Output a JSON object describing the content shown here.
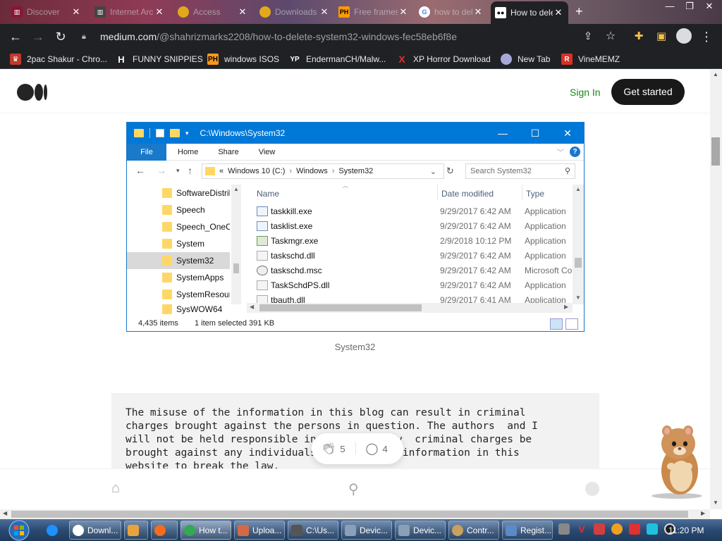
{
  "browser": {
    "tabs": [
      {
        "title": "Discover",
        "fav_color": "#8a1538",
        "active": false
      },
      {
        "title": "Internet Archive",
        "fav_color": "#444444",
        "active": false
      },
      {
        "title": "Access",
        "fav_color": "#e2a91b",
        "active": false
      },
      {
        "title": "Downloads",
        "fav_color": "#e2a91b",
        "active": false
      },
      {
        "title": "Free frames",
        "fav_color": "#f90",
        "active": false
      },
      {
        "title": "how to delete",
        "fav_color": "#4285f4",
        "active": false
      },
      {
        "title": "How to delete",
        "fav_color": "#ffffff",
        "active": true
      }
    ],
    "new_tab": "+",
    "url_host": "medium.com",
    "url_path": "/@shahrizmarks2208/how-to-delete-system32-windows-fec58eb6f8e",
    "bookmarks": [
      {
        "label": "2pac Shakur - Chro...",
        "icon": "2pac-icon",
        "color": "#c03a2b"
      },
      {
        "label": "FUNNY SNIPPIES",
        "icon": "H",
        "color": "#ffffff"
      },
      {
        "label": "windows ISOS",
        "icon": "PH",
        "color": "#f7971d"
      },
      {
        "label": "EndermanCH/Malw...",
        "icon": "YP",
        "color": "#ffffff"
      },
      {
        "label": "XP Horror Download",
        "icon": "X",
        "color": "#e52e2e"
      },
      {
        "label": "New Tab",
        "icon": "globe-icon",
        "color": "#a8a8d8"
      },
      {
        "label": "VineMEMZ",
        "icon": "R",
        "color": "#d93025"
      }
    ]
  },
  "medium": {
    "sign_in": "Sign In",
    "get_started": "Get started",
    "caption": "System32",
    "claps": "5",
    "comments": "4",
    "code_lines": [
      "The misuse of the information in this blog can result in criminal",
      "charges brought against the persons in question. The authors  and I",
      "will not be held responsible in the event any  criminal charges be",
      "brought against any individuals misusing the information in this",
      "website to break the law."
    ]
  },
  "explorer": {
    "title_path": "C:\\Windows\\System32",
    "ribbon_file": "File",
    "ribbon_tabs": [
      "Home",
      "Share",
      "View"
    ],
    "address": {
      "prefix": "«",
      "parts": [
        "Windows 10 (C:)",
        "›",
        "Windows",
        "›",
        "System32"
      ]
    },
    "search_placeholder": "Search System32",
    "nav_items": [
      "SoftwareDistrib",
      "Speech",
      "Speech_OneCo",
      "System",
      "System32",
      "SystemApps",
      "SystemResour",
      "SysWOW64"
    ],
    "nav_selected_index": 4,
    "columns": {
      "name": "Name",
      "date": "Date modified",
      "type": "Type"
    },
    "files": [
      {
        "name": "taskkill.exe",
        "date": "9/29/2017 6:42 AM",
        "type": "Application"
      },
      {
        "name": "tasklist.exe",
        "date": "9/29/2017 6:42 AM",
        "type": "Application"
      },
      {
        "name": "Taskmgr.exe",
        "date": "2/9/2018 10:12 PM",
        "type": "Application"
      },
      {
        "name": "taskschd.dll",
        "date": "9/29/2017 6:42 AM",
        "type": "Application"
      },
      {
        "name": "taskschd.msc",
        "date": "9/29/2017 6:42 AM",
        "type": "Microsoft Co"
      },
      {
        "name": "TaskSchdPS.dll",
        "date": "9/29/2017 6:42 AM",
        "type": "Application"
      },
      {
        "name": "tbauth.dll",
        "date": "9/29/2017 6:41 AM",
        "type": "Application"
      }
    ],
    "status_items": "4,435 items",
    "status_selected": "1 item selected  391 KB"
  },
  "taskbar": {
    "buttons": [
      {
        "label": "Downl...",
        "color": "#ffffff"
      },
      {
        "label": "",
        "color": "#e8a33d"
      },
      {
        "label": "",
        "color": "#f76b1c"
      },
      {
        "label": "How t...",
        "color": "#34a853"
      },
      {
        "label": "Uploa...",
        "color": "#d26a4a"
      },
      {
        "label": "C:\\Us...",
        "color": "#555555"
      },
      {
        "label": "Devic...",
        "color": "#8aa0b8"
      },
      {
        "label": "Devic...",
        "color": "#8aa0b8"
      },
      {
        "label": "Contr...",
        "color": "#c8a060"
      },
      {
        "label": "Regist...",
        "color": "#5c8ac8"
      }
    ],
    "clock": "11:20 PM"
  }
}
